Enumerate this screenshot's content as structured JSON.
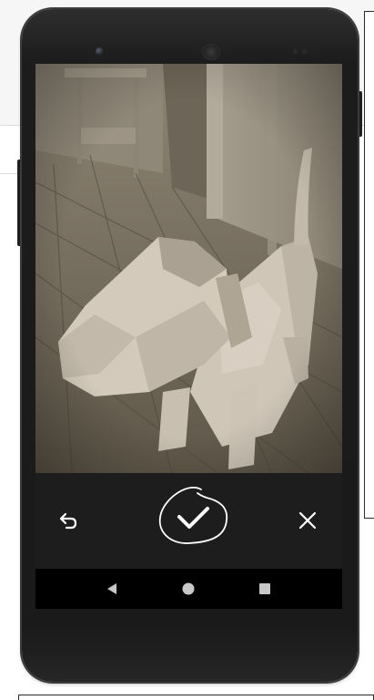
{
  "camera_confirm": {
    "retake_icon": "undo-arrow-icon",
    "done_icon": "checkmark-icon",
    "cancel_icon": "close-x-icon"
  },
  "navigation_bar": {
    "back_icon": "back-triangle-icon",
    "home_icon": "home-circle-icon",
    "recents_icon": "recents-square-icon"
  },
  "colors": {
    "phone_body": "#1c1c1c",
    "confirm_bar": "#1d1d1d",
    "nav_bar": "#000000",
    "icon_color": "#ffffff",
    "preview_tone": "#7f7668"
  }
}
